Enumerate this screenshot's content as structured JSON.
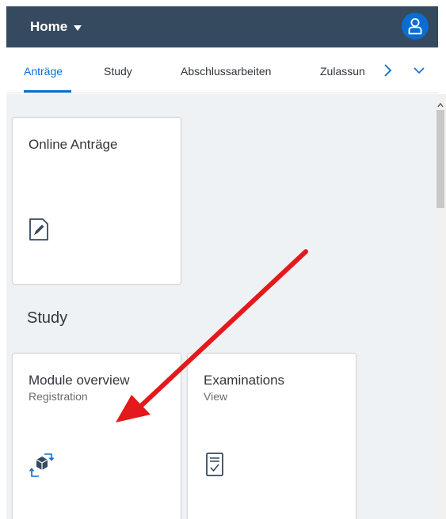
{
  "header": {
    "title": "Home",
    "accent": "#354a5f"
  },
  "tabs": [
    {
      "label": "Anträge",
      "active": true
    },
    {
      "label": "Study",
      "active": false
    },
    {
      "label": "Abschlussarbeiten",
      "active": false
    },
    {
      "label": "Zulassun",
      "active": false
    }
  ],
  "groups": {
    "first_tile": {
      "title": "Online Anträge",
      "icon": "edit-document-icon"
    },
    "study": {
      "title": "Study",
      "tiles": [
        {
          "title": "Module overview",
          "subtitle": "Registration",
          "icon": "module-registration-icon"
        },
        {
          "title": "Examinations",
          "subtitle": "View",
          "icon": "exam-checklist-icon"
        }
      ]
    }
  },
  "annotation": {
    "type": "red-arrow",
    "color": "#e3191c",
    "points_to": "module-overview-tile"
  }
}
